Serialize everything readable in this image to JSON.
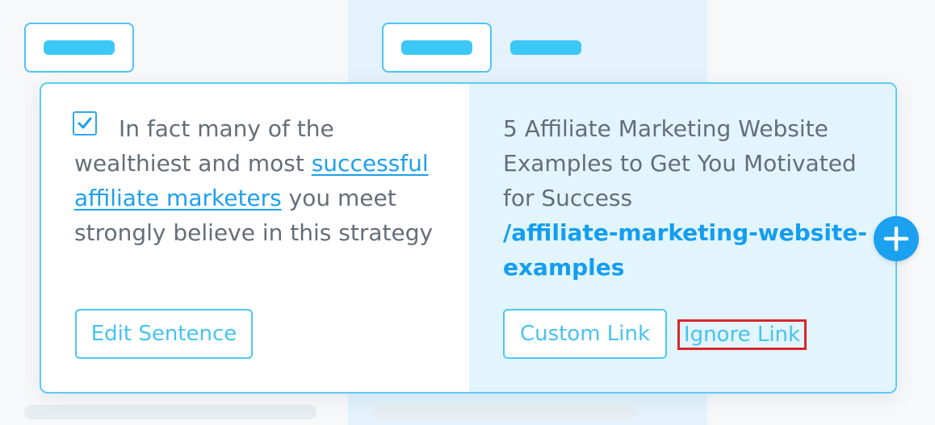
{
  "sentence_card": {
    "checked": true,
    "text_before": "In fact many of the wealthiest and most",
    "link_text": "successful affiliate marketers",
    "text_after": "you meet strongly believe in this strategy",
    "edit_button": "Edit Sentence"
  },
  "link_card": {
    "title": "5 Affiliate Marketing Website Examples to Get You Motivated for Success",
    "url": "/affiliate-marketing-website-examples",
    "custom_link_button": "Custom Link",
    "ignore_link_button": "Ignore Link"
  },
  "icons": {
    "checkbox": "check-icon",
    "add": "plus-icon"
  },
  "colors": {
    "accent": "#1ba1f0",
    "link": "#1ea0ea",
    "border": "#5ccbf4",
    "highlight": "#d9262c"
  }
}
